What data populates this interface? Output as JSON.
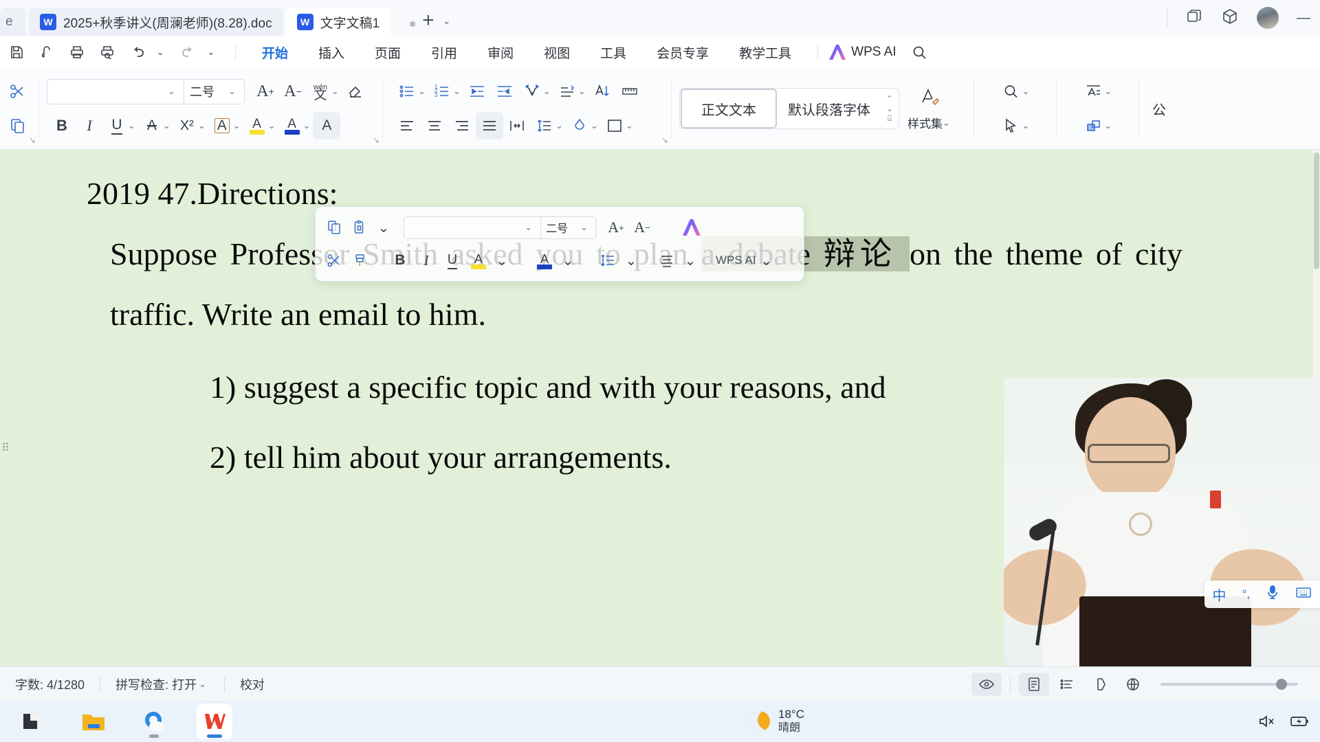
{
  "tabbar": {
    "ghost_tab_label": "e",
    "tabs": [
      {
        "label": "2025+秋季讲义(周澜老师)(8.28).doc",
        "icon": "word-icon",
        "active": false
      },
      {
        "label": "文字文稿1",
        "icon": "word-icon",
        "active": true
      }
    ],
    "new_tab_label": "+",
    "new_tab_dropdown": "⌄",
    "right_icons": [
      "window-restore-icon",
      "cube-icon",
      "avatar",
      "minimize-icon"
    ],
    "minimize_label": "—"
  },
  "menubar": {
    "quick_access": [
      "save-icon",
      "cloud-sync-icon",
      "print-icon",
      "print-preview-icon",
      "undo-icon",
      "redo-icon",
      "customize-icon"
    ],
    "undo_caret": "⌄",
    "redo_caret": "",
    "more_caret": "⌄",
    "items": [
      {
        "label": "开始",
        "active": true
      },
      {
        "label": "插入",
        "active": false
      },
      {
        "label": "页面",
        "active": false
      },
      {
        "label": "引用",
        "active": false
      },
      {
        "label": "审阅",
        "active": false
      },
      {
        "label": "视图",
        "active": false
      },
      {
        "label": "工具",
        "active": false
      },
      {
        "label": "会员专享",
        "active": false
      },
      {
        "label": "教学工具",
        "active": false
      }
    ],
    "wps_ai_label": "WPS AI",
    "search_icon": "search-icon"
  },
  "ribbon": {
    "clipboard": {
      "cut_icon": "scissors-icon",
      "copy_icon": "copy-icon",
      "paste_icon": "paste-icon",
      "format_painter_icon": "format-painter-icon"
    },
    "font": {
      "family_value": "",
      "family_placeholder": "",
      "size_value": "二号",
      "grow_label": "A",
      "grow_sup": "+",
      "shrink_label": "A",
      "shrink_sup": "−",
      "pinyin_label": "wén",
      "pinyin_glyph": "文",
      "clear_format_icon": "eraser-icon",
      "bold_label": "B",
      "italic_label": "I",
      "underline_label": "U",
      "strikethrough_label": "A",
      "superscript_label": "X²",
      "char_border_label": "A",
      "highlight_label": "A",
      "font_color_label": "A",
      "char_shading_label": "A",
      "caret": "⌄"
    },
    "paragraph": {
      "bullets_icon": "bullet-list-icon",
      "numbering_icon": "numbered-list-icon",
      "outdent_icon": "decrease-indent-icon",
      "indent_icon": "increase-indent-icon",
      "text_direction_icon": "text-direction-icon",
      "align_left_icon": "align-left-icon",
      "align_center_icon": "align-center-icon",
      "align_right_icon": "align-right-icon",
      "justify_icon": "justify-icon",
      "distribute_icon": "distribute-icon",
      "line_spacing_icon": "line-spacing-icon",
      "paragraph_layout_icon": "paragraph-layout-icon",
      "sort_icon": "sort-icon",
      "show_marks_icon": "show-formatting-marks-icon",
      "shading_icon": "shading-icon",
      "borders_icon": "borders-icon",
      "caret": "⌄"
    },
    "styles": {
      "current_style": "正文文本",
      "paragraph_font": "默认段落字体",
      "scroll_up": "⌃",
      "scroll_down": "⌄",
      "expand": "⌸",
      "style_set_label": "样式集",
      "style_set_icon": "style-brush-icon"
    },
    "editing": {
      "find_icon": "search-icon",
      "select_icon": "cursor-select-icon",
      "format_select_icon": "select-text-icon",
      "arrange_icon": "arrange-objects-icon",
      "caret": "⌄"
    },
    "last_group_label": "公",
    "dialog_launcher": "↘"
  },
  "mini_toolbar": {
    "copy_icon": "copy-icon",
    "paste_icon": "paste-icon",
    "cut_icon": "scissors-icon",
    "format_painter_icon": "format-painter-icon",
    "font_family_value": "",
    "font_size_value": "二号",
    "grow_label": "A",
    "grow_sup": "+",
    "shrink_label": "A",
    "shrink_sup": "−",
    "ai_icon": "wps-ai-logo",
    "bold_label": "B",
    "italic_label": "I",
    "underline_label": "U",
    "highlight_label": "A",
    "font_color_label": "A",
    "line_spacing_icon": "line-spacing-icon",
    "align_icon": "align-icon",
    "wps_ai_label": "WPS AI",
    "caret": "⌄"
  },
  "document": {
    "background_color": "#e2f0d9",
    "selection_color": "#b7c4ab",
    "paragraphs": [
      {
        "id": "heading",
        "text": "2019 47.Directions:"
      },
      {
        "id": "body_pre",
        "text": "Suppose Professor Smith asked you to plan "
      },
      {
        "id": "body_sel1",
        "text": "a debate 辩论 "
      },
      {
        "id": "body_post",
        "text": "on the theme of city traffic. Write an email to him."
      },
      {
        "id": "item1",
        "text": "1)   suggest a specific topic and with your reasons, and"
      },
      {
        "id": "item2",
        "text": "2)   tell him about your arrangements."
      }
    ],
    "paragraph_handle_icon": "paragraph-drag-handle-icon"
  },
  "statusbar": {
    "word_count": "字数: 4/1280",
    "spellcheck": "拼写检查: 打开",
    "spellcheck_caret": "⌄",
    "proofread": "校对",
    "view_buttons": [
      {
        "name": "reading-layout-icon",
        "active": true
      },
      {
        "name": "page-layout-icon",
        "active": true
      },
      {
        "name": "outline-icon",
        "active": false
      },
      {
        "name": "web-layout-icon",
        "active": false
      },
      {
        "name": "presentation-icon",
        "active": false
      }
    ],
    "zoom_level": ""
  },
  "ime": {
    "language_label": "中",
    "punctuation_label": "°,",
    "mic_icon": "microphone-icon",
    "keyboard_icon": "keyboard-icon"
  },
  "taskbar": {
    "apps": [
      {
        "name": "start-icon",
        "label": "",
        "running": false,
        "active": false
      },
      {
        "name": "file-explorer-icon",
        "label": "",
        "running": false,
        "active": false
      },
      {
        "name": "browser-icon",
        "label": "",
        "running": true,
        "active": false
      },
      {
        "name": "wps-office-icon",
        "label": "W",
        "running": true,
        "active": true
      }
    ],
    "weather": {
      "temperature": "18°C",
      "condition": "晴朗",
      "icon": "moon-icon"
    },
    "tray": [
      {
        "name": "volume-muted-icon",
        "glyph": "🔇"
      },
      {
        "name": "battery-charging-icon",
        "glyph": "🔋"
      }
    ]
  }
}
